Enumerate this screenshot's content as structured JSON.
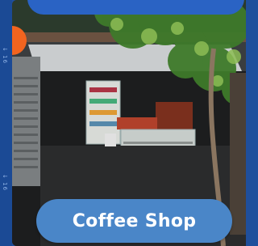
{
  "header": {
    "title_partial": ""
  },
  "card": {
    "label": "Coffee Shop"
  },
  "side_marks": [
    "↓ 16",
    "↓ 16"
  ],
  "colors": {
    "page_bg": "#1f4f9c",
    "pill": "#4a86c8",
    "top_pill": "#2a63c4"
  }
}
